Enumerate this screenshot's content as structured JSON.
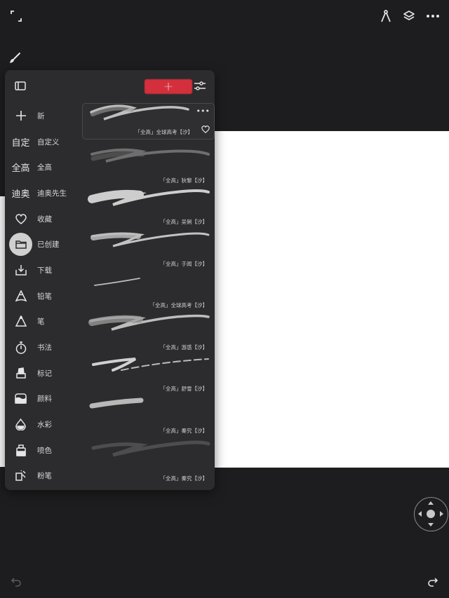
{
  "toolbar": {
    "icons": [
      "fullscreen-icon",
      "brush-icon",
      "selection-icon",
      "layers-icon",
      "more-icon",
      "undo-icon",
      "redo-icon",
      "nav-pad-icon"
    ]
  },
  "panel": {
    "add_label": "+",
    "categories": [
      {
        "icon_text": "",
        "icon": "plus-icon",
        "label": "新"
      },
      {
        "icon_text": "自定",
        "icon": "",
        "label": "自定义"
      },
      {
        "icon_text": "全高",
        "icon": "",
        "label": "全高"
      },
      {
        "icon_text": "迪奥",
        "icon": "",
        "label": "迪奥先生"
      },
      {
        "icon_text": "",
        "icon": "heart-icon",
        "label": "收藏"
      },
      {
        "icon_text": "",
        "icon": "folder-icon",
        "label": "已创建",
        "active": true
      },
      {
        "icon_text": "",
        "icon": "download-icon",
        "label": "下载"
      },
      {
        "icon_text": "",
        "icon": "pencil-icon",
        "label": "铅笔"
      },
      {
        "icon_text": "",
        "icon": "pen-icon",
        "label": "笔"
      },
      {
        "icon_text": "",
        "icon": "calligraphy-icon",
        "label": "书法"
      },
      {
        "icon_text": "",
        "icon": "marker-icon",
        "label": "标记"
      },
      {
        "icon_text": "",
        "icon": "paint-icon",
        "label": "颜料"
      },
      {
        "icon_text": "",
        "icon": "watercolor-icon",
        "label": "水彩"
      },
      {
        "icon_text": "",
        "icon": "spray-icon",
        "label": "喷色"
      },
      {
        "icon_text": "",
        "icon": "chalk-icon",
        "label": "粉笔"
      }
    ],
    "brushes": [
      {
        "name": "「全高」全球高考【汐】",
        "selected": true
      },
      {
        "name": "「全高」狄黎【汐】"
      },
      {
        "name": "「全高」吴俐【汐】"
      },
      {
        "name": "「全高」于闻【汐】"
      },
      {
        "name": "「全高」全球高考【汐】"
      },
      {
        "name": "「全高」游惑【汐】"
      },
      {
        "name": "「全高」舒雪【汐】"
      },
      {
        "name": "「全高」秦究【汐】"
      },
      {
        "name": "「全高」秦究【汐】"
      }
    ],
    "more_label": "•••"
  },
  "colors": {
    "background": "#1d1d1f",
    "panel": "#2c2c2e",
    "accent_red": "#d32f3c",
    "canvas": "#ffffff"
  }
}
